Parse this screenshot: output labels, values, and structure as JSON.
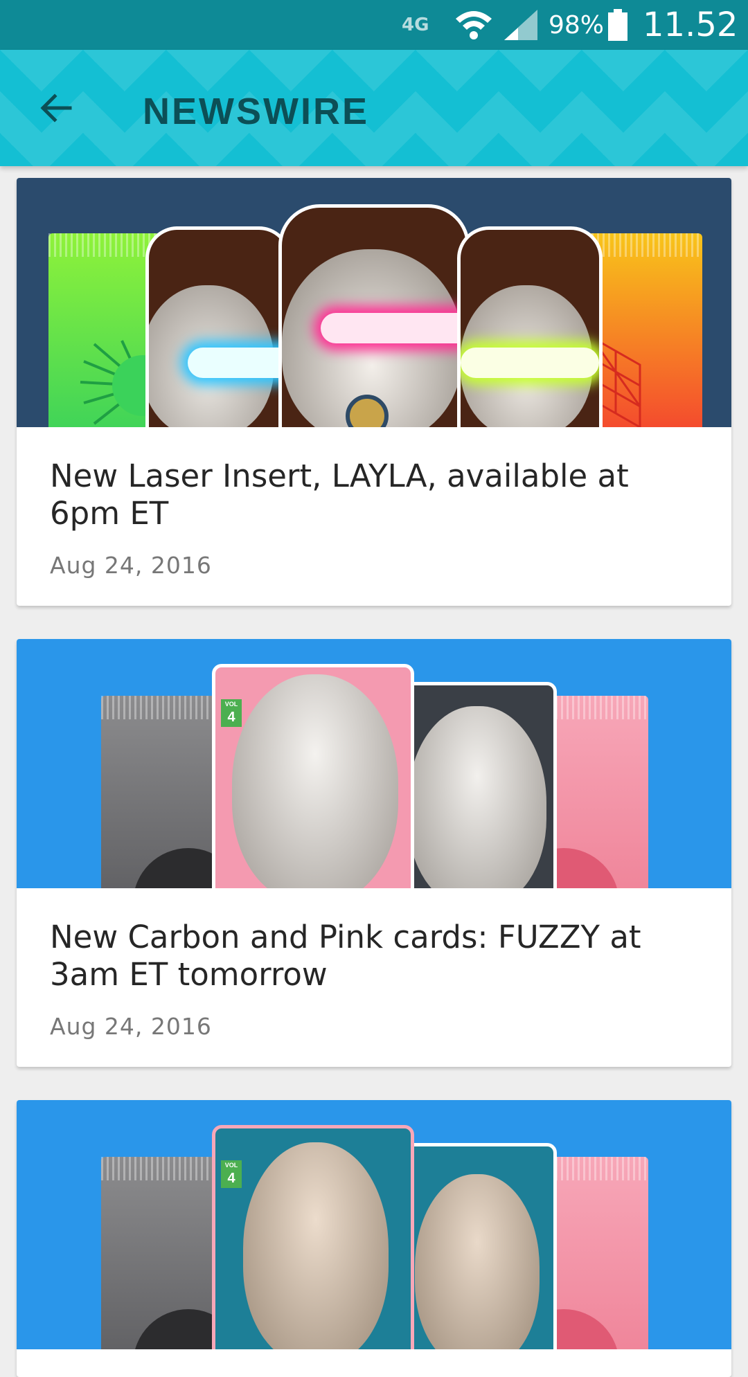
{
  "status_bar": {
    "network": "4G",
    "battery": "98%",
    "time": "11.52"
  },
  "app_bar": {
    "title": "NEWSWIRE",
    "back_icon": "arrow-back-icon"
  },
  "colors": {
    "status_bar": "#0e8a96",
    "app_bar": "#14bfd3",
    "title": "#0c4f56",
    "card1_bg": "#2b4b6d",
    "card2_bg": "#2a96ea",
    "laser_blue": "#2ec5ff",
    "laser_pink": "#ff2e93",
    "laser_green": "#c6ff2e"
  },
  "news": [
    {
      "title": "New Laser Insert, LAYLA, available at 6pm ET",
      "date": "Aug 24, 2016"
    },
    {
      "title": "New Carbon and Pink cards: FUZZY at 3am ET tomorrow",
      "date": "Aug 24, 2016"
    },
    {
      "title": "",
      "date": ""
    }
  ],
  "badges": {
    "vol_label": "VOL",
    "vol_number": "4"
  }
}
